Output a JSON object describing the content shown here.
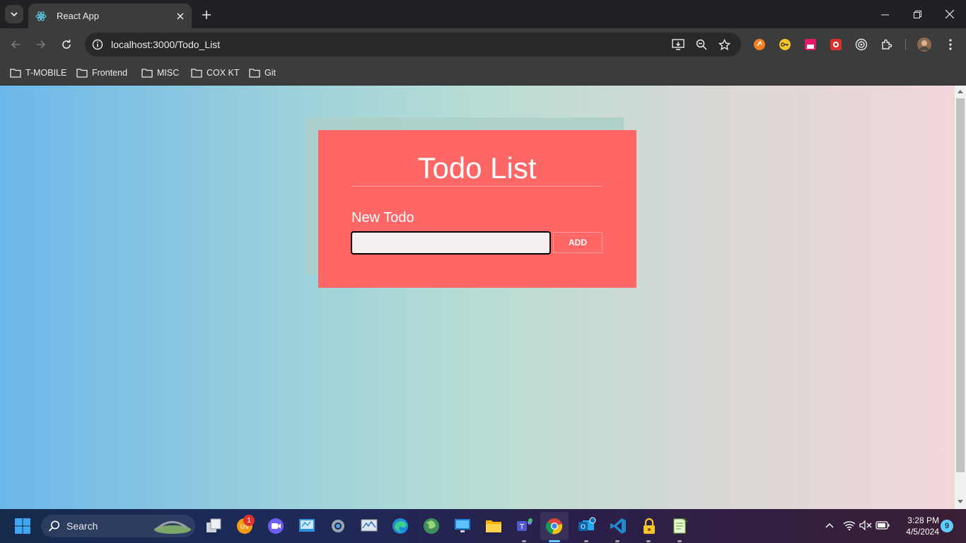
{
  "browser": {
    "tab_title": "React App",
    "url": "localhost:3000/Todo_List",
    "bookmarks": [
      "T-MOBILE",
      "Frontend",
      "MISC",
      "COX KT",
      "Git"
    ]
  },
  "app": {
    "title": "Todo List",
    "new_todo_label": "New Todo",
    "input_value": "",
    "add_button": "ADD",
    "colors": {
      "card": "#ff6767",
      "background_left": "#6cb7ea",
      "background_right": "#f2d6da"
    }
  },
  "taskbar": {
    "search_label": "Search",
    "uv_badge": "1",
    "time": "3:28 PM",
    "date": "4/5/2024",
    "notifications": "9",
    "icons": [
      "windows-start-icon",
      "task-view-icon",
      "uv-app-icon",
      "video-call-icon",
      "whiteboard-icon",
      "settings-icon",
      "monitor-icon",
      "edge-icon",
      "globe-app-icon",
      "remote-desktop-icon",
      "file-explorer-icon",
      "teams-icon",
      "chrome-icon",
      "outlook-icon",
      "vscode-icon",
      "lock-app-icon",
      "notepad-icon"
    ]
  }
}
